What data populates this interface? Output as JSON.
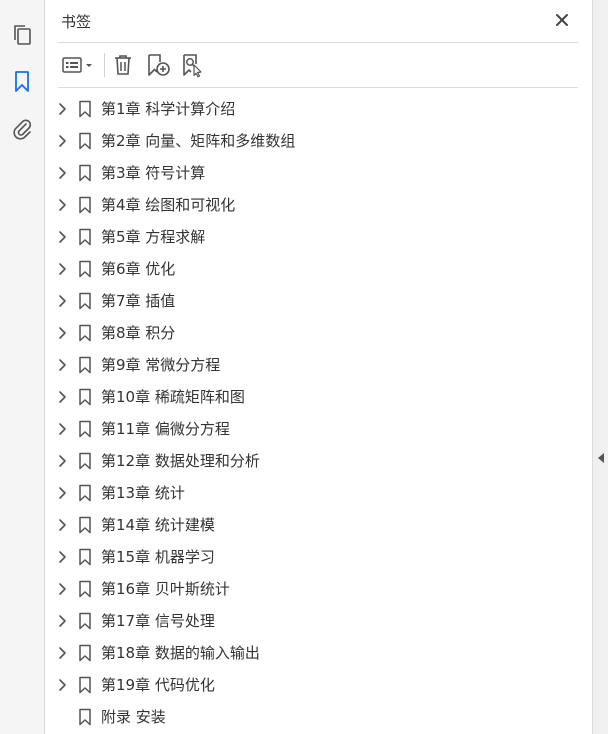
{
  "rail": {
    "items": [
      {
        "icon": "pages-icon"
      },
      {
        "icon": "bookmark-icon",
        "active": true
      },
      {
        "icon": "paperclip-icon"
      }
    ],
    "active_color": "#1473e6"
  },
  "panel": {
    "title": "书签",
    "close_icon": "close-icon"
  },
  "toolbar": {
    "items": [
      {
        "icon": "options-menu-icon"
      },
      {
        "icon": "trash-icon"
      },
      {
        "icon": "new-bookmark-icon"
      },
      {
        "icon": "find-bookmark-icon"
      }
    ]
  },
  "bookmarks": [
    {
      "label": "第1章 科学计算介绍",
      "expandable": true
    },
    {
      "label": "第2章 向量、矩阵和多维数组",
      "expandable": true
    },
    {
      "label": "第3章 符号计算",
      "expandable": true
    },
    {
      "label": "第4章 绘图和可视化",
      "expandable": true
    },
    {
      "label": "第5章 方程求解",
      "expandable": true
    },
    {
      "label": "第6章 优化",
      "expandable": true
    },
    {
      "label": "第7章 插值",
      "expandable": true
    },
    {
      "label": "第8章 积分",
      "expandable": true
    },
    {
      "label": "第9章 常微分方程",
      "expandable": true
    },
    {
      "label": "第10章 稀疏矩阵和图",
      "expandable": true
    },
    {
      "label": "第11章 偏微分方程",
      "expandable": true
    },
    {
      "label": "第12章 数据处理和分析",
      "expandable": true
    },
    {
      "label": "第13章 统计",
      "expandable": true
    },
    {
      "label": "第14章 统计建模",
      "expandable": true
    },
    {
      "label": "第15章 机器学习",
      "expandable": true
    },
    {
      "label": "第16章 贝叶斯统计",
      "expandable": true
    },
    {
      "label": "第17章 信号处理",
      "expandable": true
    },
    {
      "label": "第18章 数据的输入输出",
      "expandable": true
    },
    {
      "label": "第19章 代码优化",
      "expandable": true
    },
    {
      "label": "附录 安装",
      "expandable": false
    }
  ]
}
